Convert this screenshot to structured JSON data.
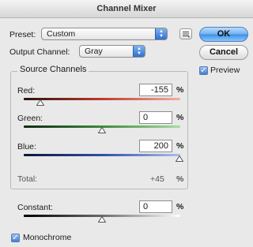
{
  "window": {
    "title": "Channel Mixer"
  },
  "preset": {
    "label": "Preset:",
    "value": "Custom"
  },
  "output_channel": {
    "label": "Output Channel:",
    "value": "Gray"
  },
  "buttons": {
    "ok": "OK",
    "cancel": "Cancel"
  },
  "preview": {
    "label": "Preview",
    "checked": true
  },
  "source_channels": {
    "title": "Source Channels",
    "red": {
      "label": "Red:",
      "value": "-155",
      "unit": "%"
    },
    "green": {
      "label": "Green:",
      "value": "0",
      "unit": "%"
    },
    "blue": {
      "label": "Blue:",
      "value": "200",
      "unit": "%"
    }
  },
  "total": {
    "label": "Total:",
    "value": "+45",
    "unit": "%"
  },
  "constant": {
    "label": "Constant:",
    "value": "0",
    "unit": "%"
  },
  "monochrome": {
    "label": "Monochrome",
    "checked": true
  },
  "colors": {
    "red_track": "#c0392b",
    "green_track": "#3d8b3d",
    "blue_track": "#2e4fa8",
    "gray_track": "#2b2b2b",
    "ok_button": "#5aa2ee"
  }
}
